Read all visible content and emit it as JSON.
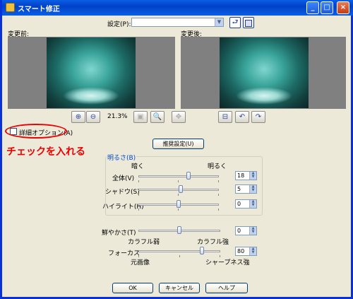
{
  "window": {
    "title": "スマート修正",
    "min_glyph": "_",
    "max_glyph": "□",
    "close_glyph": "×"
  },
  "settings": {
    "label": "設定(P):",
    "value": ""
  },
  "preview": {
    "before_label": "変更前:",
    "after_label": "変更後:"
  },
  "zoom": {
    "level": "21.3%"
  },
  "details": {
    "checkbox_label": "詳細オプション(A)",
    "checked": false
  },
  "annotation": {
    "text": "チェックを入れる"
  },
  "recommend_button": "推奨設定(U)",
  "brightness": {
    "group_label": "明るさ(B)",
    "dark_label": "暗く",
    "bright_label": "明るく",
    "rows": [
      {
        "label": "全体(V)",
        "value": "18",
        "fraction": 0.62
      },
      {
        "label": "シャドウ(S)",
        "value": "5",
        "fraction": 0.53
      },
      {
        "label": "ハイライト(H)",
        "value": "0",
        "fraction": 0.5
      }
    ]
  },
  "saturation": {
    "label": "鮮やかさ(T)",
    "value": "0",
    "fraction": 0.5,
    "weak_label": "カラフル弱",
    "strong_label": "カラフル強"
  },
  "focus": {
    "label": "フォーカス",
    "value": "80",
    "fraction": 0.78,
    "original_label": "元画像",
    "sharp_label": "シャープネス強"
  },
  "buttons": {
    "ok": "OK",
    "cancel": "キャンセル",
    "help": "ヘルプ"
  },
  "colors": {
    "title_bar": "#0a5fe6",
    "annotation": "#e00000",
    "group_label": "#0046d5"
  }
}
